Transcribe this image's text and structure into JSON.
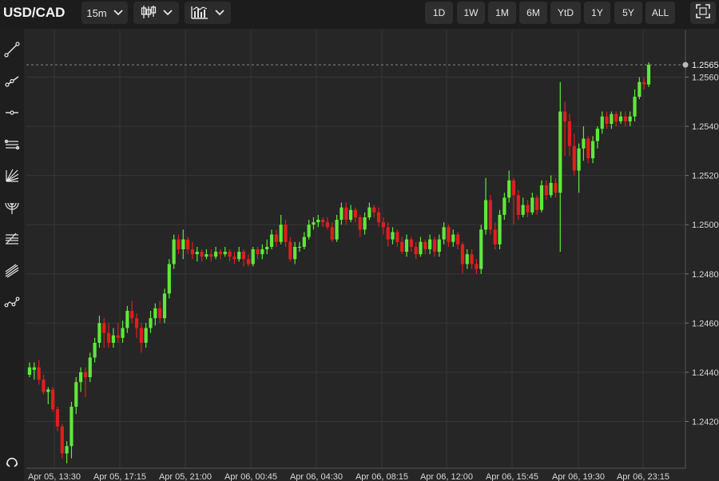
{
  "toolbar": {
    "symbol": "USD/CAD",
    "interval": "15m",
    "chart_type_icon": "candlestick-icon",
    "indicators_icon": "indicators-icon",
    "ranges": [
      "1D",
      "1W",
      "1M",
      "6M",
      "YtD",
      "1Y",
      "5Y",
      "ALL"
    ],
    "expand_icon": "fullscreen-icon"
  },
  "sidebar": {
    "tools": [
      "trend-line-icon",
      "ray-icon",
      "horizontal-line-icon",
      "parallel-channel-icon",
      "fan-icon",
      "arc-icon",
      "fibonacci-icon",
      "pitchfork-icon",
      "path-icon"
    ],
    "bottom_tool": "magnet-icon"
  },
  "colors": {
    "up": "#5fe83a",
    "down": "#e01e1e",
    "background": "#262626",
    "grid": "#363636",
    "last_price_line": "#8a8a8a"
  },
  "chart_data": {
    "type": "candlestick",
    "title": "",
    "x_ticks": [
      "Apr 05, 13:30",
      "Apr 05, 17:15",
      "Apr 05, 21:00",
      "Apr 06, 00:45",
      "Apr 06, 04:30",
      "Apr 06, 08:15",
      "Apr 06, 12:00",
      "Apr 06, 15:45",
      "Apr 06, 19:30",
      "Apr 06, 23:15"
    ],
    "y_ticks": [
      1.242,
      1.244,
      1.246,
      1.248,
      1.25,
      1.252,
      1.254,
      1.256
    ],
    "y_range": [
      1.2401,
      1.2579
    ],
    "last_price": 1.2565,
    "grid": true,
    "candles": [
      [
        1.2439,
        1.2442,
        1.2438,
        1.2444
      ],
      [
        1.2441,
        1.2442,
        1.2437,
        1.2444
      ],
      [
        1.2442,
        1.2437,
        1.2435,
        1.2445
      ],
      [
        1.2437,
        1.2432,
        1.2431,
        1.2439
      ],
      [
        1.2432,
        1.2433,
        1.2427,
        1.2434
      ],
      [
        1.2433,
        1.2425,
        1.2424,
        1.2434
      ],
      [
        1.2425,
        1.2418,
        1.2416,
        1.2426
      ],
      [
        1.2418,
        1.2407,
        1.2405,
        1.2419
      ],
      [
        1.2407,
        1.241,
        1.2403,
        1.2412
      ],
      [
        1.241,
        1.2426,
        1.2405,
        1.2428
      ],
      [
        1.2426,
        1.2436,
        1.2423,
        1.2438
      ],
      [
        1.2436,
        1.244,
        1.2432,
        1.2442
      ],
      [
        1.244,
        1.2438,
        1.243,
        1.2442
      ],
      [
        1.2438,
        1.2446,
        1.2436,
        1.2448
      ],
      [
        1.2446,
        1.2452,
        1.2444,
        1.2454
      ],
      [
        1.2452,
        1.246,
        1.245,
        1.2463
      ],
      [
        1.246,
        1.2456,
        1.245,
        1.2462
      ],
      [
        1.2456,
        1.2452,
        1.245,
        1.246
      ],
      [
        1.2452,
        1.2455,
        1.245,
        1.2458
      ],
      [
        1.2455,
        1.2454,
        1.2452,
        1.246
      ],
      [
        1.2454,
        1.2458,
        1.2452,
        1.2461
      ],
      [
        1.2458,
        1.2465,
        1.2456,
        1.2467
      ],
      [
        1.2465,
        1.2462,
        1.246,
        1.2469
      ],
      [
        1.2462,
        1.2458,
        1.2454,
        1.2464
      ],
      [
        1.2458,
        1.2452,
        1.2448,
        1.246
      ],
      [
        1.2452,
        1.2458,
        1.245,
        1.246
      ],
      [
        1.2458,
        1.2462,
        1.2456,
        1.2465
      ],
      [
        1.2462,
        1.2466,
        1.2459,
        1.2468
      ],
      [
        1.2466,
        1.2462,
        1.246,
        1.2469
      ],
      [
        1.2462,
        1.2472,
        1.246,
        1.2474
      ],
      [
        1.2472,
        1.2484,
        1.247,
        1.2486
      ],
      [
        1.2484,
        1.2494,
        1.2482,
        1.2496
      ],
      [
        1.2494,
        1.249,
        1.2488,
        1.2496
      ],
      [
        1.249,
        1.2494,
        1.2486,
        1.2498
      ],
      [
        1.2494,
        1.249,
        1.2488,
        1.2495
      ],
      [
        1.249,
        1.2488,
        1.2486,
        1.2493
      ],
      [
        1.2488,
        1.2489,
        1.2485,
        1.2491
      ],
      [
        1.2489,
        1.2487,
        1.2485,
        1.249
      ],
      [
        1.2487,
        1.2488,
        1.2486,
        1.249
      ],
      [
        1.2488,
        1.2487,
        1.2485,
        1.249
      ],
      [
        1.2487,
        1.2489,
        1.2486,
        1.2491
      ],
      [
        1.2489,
        1.2488,
        1.2486,
        1.249
      ],
      [
        1.2488,
        1.2489,
        1.2487,
        1.2491
      ],
      [
        1.2489,
        1.2487,
        1.2485,
        1.249
      ],
      [
        1.2487,
        1.2486,
        1.2484,
        1.2489
      ],
      [
        1.2486,
        1.2489,
        1.2485,
        1.2491
      ],
      [
        1.2489,
        1.2486,
        1.2483,
        1.249
      ],
      [
        1.2486,
        1.2484,
        1.2483,
        1.2488
      ],
      [
        1.2484,
        1.249,
        1.2483,
        1.2491
      ],
      [
        1.249,
        1.2488,
        1.2486,
        1.2491
      ],
      [
        1.2488,
        1.249,
        1.2486,
        1.2492
      ],
      [
        1.249,
        1.2491,
        1.2488,
        1.2494
      ],
      [
        1.2491,
        1.2496,
        1.249,
        1.2498
      ],
      [
        1.2496,
        1.2493,
        1.2491,
        1.2498
      ],
      [
        1.2493,
        1.25,
        1.2492,
        1.2504
      ],
      [
        1.25,
        1.2493,
        1.2491,
        1.2502
      ],
      [
        1.2493,
        1.2486,
        1.2485,
        1.2495
      ],
      [
        1.2486,
        1.2491,
        1.2484,
        1.2493
      ],
      [
        1.2491,
        1.2491,
        1.2489,
        1.2493
      ],
      [
        1.2491,
        1.2495,
        1.249,
        1.2497
      ],
      [
        1.2495,
        1.25,
        1.2494,
        1.2502
      ],
      [
        1.25,
        1.2501,
        1.2498,
        1.2503
      ],
      [
        1.2501,
        1.2502,
        1.2499,
        1.2504
      ],
      [
        1.2502,
        1.2501,
        1.2499,
        1.2503
      ],
      [
        1.2501,
        1.2499,
        1.2498,
        1.2503
      ],
      [
        1.2499,
        1.2494,
        1.2493,
        1.2501
      ],
      [
        1.2494,
        1.2502,
        1.2493,
        1.2504
      ],
      [
        1.2502,
        1.2507,
        1.25,
        1.2509
      ],
      [
        1.2507,
        1.2502,
        1.25,
        1.2509
      ],
      [
        1.2502,
        1.2506,
        1.2501,
        1.2508
      ],
      [
        1.2506,
        1.2503,
        1.2501,
        1.2507
      ],
      [
        1.2503,
        1.2498,
        1.2495,
        1.2504
      ],
      [
        1.2498,
        1.2503,
        1.2496,
        1.2505
      ],
      [
        1.2503,
        1.2507,
        1.2502,
        1.2509
      ],
      [
        1.2507,
        1.2505,
        1.2503,
        1.2508
      ],
      [
        1.2505,
        1.2501,
        1.2499,
        1.2507
      ],
      [
        1.2501,
        1.2499,
        1.2496,
        1.2503
      ],
      [
        1.2499,
        1.2494,
        1.2491,
        1.2501
      ],
      [
        1.2494,
        1.2497,
        1.2492,
        1.2499
      ],
      [
        1.2497,
        1.2493,
        1.2491,
        1.2498
      ],
      [
        1.2493,
        1.2489,
        1.2488,
        1.2495
      ],
      [
        1.2489,
        1.2494,
        1.2487,
        1.2496
      ],
      [
        1.2494,
        1.2491,
        1.2489,
        1.2495
      ],
      [
        1.2491,
        1.2488,
        1.2486,
        1.2493
      ],
      [
        1.2488,
        1.2493,
        1.2487,
        1.2495
      ],
      [
        1.2493,
        1.249,
        1.2488,
        1.2494
      ],
      [
        1.249,
        1.2494,
        1.2488,
        1.2496
      ],
      [
        1.2494,
        1.2489,
        1.2487,
        1.2495
      ],
      [
        1.2489,
        1.2494,
        1.2487,
        1.2496
      ],
      [
        1.2494,
        1.2499,
        1.2492,
        1.2501
      ],
      [
        1.2499,
        1.2493,
        1.2491,
        1.25
      ],
      [
        1.2493,
        1.2496,
        1.2491,
        1.2498
      ],
      [
        1.2496,
        1.2492,
        1.249,
        1.2497
      ],
      [
        1.2492,
        1.2484,
        1.248,
        1.2493
      ],
      [
        1.2484,
        1.2488,
        1.2482,
        1.249
      ],
      [
        1.2488,
        1.2484,
        1.2482,
        1.249
      ],
      [
        1.2484,
        1.2482,
        1.248,
        1.2486
      ],
      [
        1.2482,
        1.2498,
        1.248,
        1.25
      ],
      [
        1.2498,
        1.251,
        1.2496,
        1.2519
      ],
      [
        1.251,
        1.2498,
        1.2496,
        1.2512
      ],
      [
        1.2498,
        1.2492,
        1.249,
        1.2501
      ],
      [
        1.2492,
        1.2504,
        1.249,
        1.2506
      ],
      [
        1.2504,
        1.2511,
        1.2502,
        1.2513
      ],
      [
        1.2511,
        1.2518,
        1.2509,
        1.2522
      ],
      [
        1.2518,
        1.2512,
        1.25,
        1.2519
      ],
      [
        1.2512,
        1.2504,
        1.2502,
        1.2514
      ],
      [
        1.2504,
        1.2508,
        1.2503,
        1.2511
      ],
      [
        1.2508,
        1.2505,
        1.2503,
        1.251
      ],
      [
        1.2505,
        1.2511,
        1.2504,
        1.2513
      ],
      [
        1.2511,
        1.2506,
        1.2504,
        1.2512
      ],
      [
        1.2506,
        1.2516,
        1.2505,
        1.2518
      ],
      [
        1.2516,
        1.2512,
        1.251,
        1.2518
      ],
      [
        1.2512,
        1.2517,
        1.2511,
        1.252
      ],
      [
        1.2517,
        1.2513,
        1.2511,
        1.2519
      ],
      [
        1.2513,
        1.2546,
        1.2489,
        1.2558
      ],
      [
        1.2546,
        1.2542,
        1.2528,
        1.255
      ],
      [
        1.2542,
        1.2532,
        1.2528,
        1.2545
      ],
      [
        1.2532,
        1.2522,
        1.252,
        1.2537
      ],
      [
        1.2522,
        1.2531,
        1.2513,
        1.2533
      ],
      [
        1.2531,
        1.2535,
        1.2526,
        1.254
      ],
      [
        1.2535,
        1.2527,
        1.2525,
        1.2536
      ],
      [
        1.2527,
        1.2534,
        1.2525,
        1.2536
      ],
      [
        1.2534,
        1.2539,
        1.2531,
        1.254
      ],
      [
        1.2539,
        1.2544,
        1.2537,
        1.2546
      ],
      [
        1.2544,
        1.2541,
        1.2539,
        1.2546
      ],
      [
        1.2541,
        1.2545,
        1.2539,
        1.2546
      ],
      [
        1.2545,
        1.2542,
        1.254,
        1.2546
      ],
      [
        1.2542,
        1.2544,
        1.2541,
        1.2546
      ],
      [
        1.2544,
        1.2542,
        1.254,
        1.2546
      ],
      [
        1.2542,
        1.2544,
        1.254,
        1.2546
      ],
      [
        1.2544,
        1.2552,
        1.2542,
        1.2555
      ],
      [
        1.2552,
        1.2558,
        1.2551,
        1.256
      ],
      [
        1.2558,
        1.2557,
        1.2555,
        1.256
      ],
      [
        1.2557,
        1.2565,
        1.2556,
        1.2566
      ]
    ]
  }
}
